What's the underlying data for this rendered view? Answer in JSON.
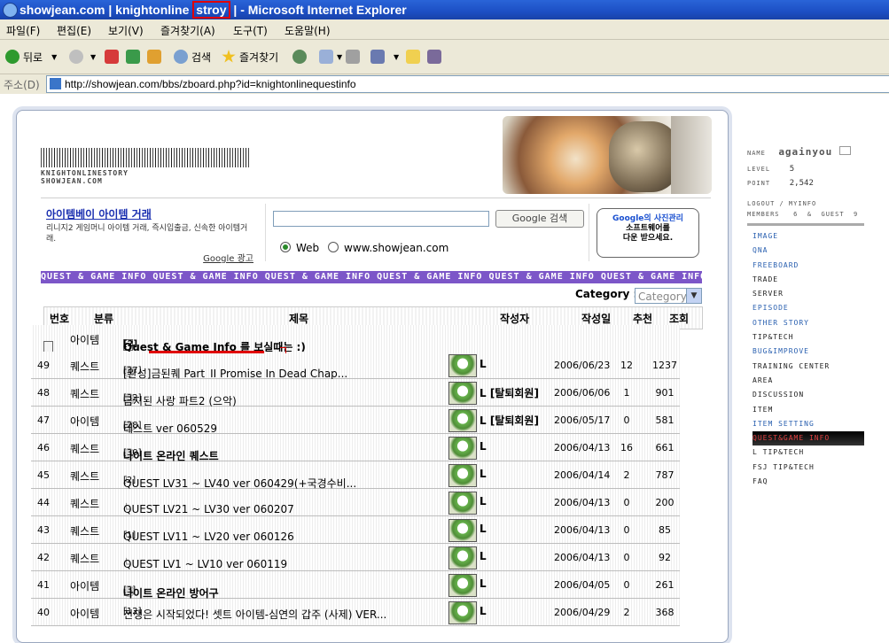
{
  "window": {
    "title_pre": "showjean.com | knightonline ",
    "title_highlight": "stroy",
    "title_post": " | - Microsoft Internet Explorer"
  },
  "menu": [
    "파일(F)",
    "편집(E)",
    "보기(V)",
    "즐겨찾기(A)",
    "도구(T)",
    "도움말(H)"
  ],
  "toolbar": {
    "back": "뒤로",
    "search": "검색",
    "favorites": "즐겨찾기"
  },
  "address": {
    "label": "주소(D)",
    "url": "http://showjean.com/bbs/zboard.php?id=knightonlinequestinfo"
  },
  "site": {
    "brand_line1": "KNIGHTONLINESTORY",
    "brand_line2": "SHOWJEAN.COM"
  },
  "ad": {
    "title": "아이템베이 아이템 거래",
    "desc": "리니지2 게임머니 아이템 거래, 즉시입출금, 신속한 아이템거래.",
    "google_label": "Google 광고"
  },
  "search": {
    "button": "Google 검색",
    "radio_web": "Web",
    "radio_site": "www.showjean.com",
    "promo_line1": "Google의 사진관리",
    "promo_line2": "소프트웨어를",
    "promo_line3": "다운 받으세요."
  },
  "marquee": "QUEST & GAME INFO QUEST & GAME INFO QUEST & GAME INFO QUEST & GAME INFO QUEST & GAME INFO QUEST & GAME INFO",
  "category": {
    "label": "Category :",
    "selected": "Category"
  },
  "table": {
    "headers": {
      "no": "번호",
      "cat": "분류",
      "title": "제목",
      "writer": "작성자",
      "date": "작성일",
      "rec": "추천",
      "views": "조회"
    },
    "notice": {
      "cat": "아이템",
      "title": "Quest & Game Info 를 보실때는 :)",
      "comments": "[2]"
    },
    "rows": [
      {
        "no": "49",
        "cat": "퀘스트",
        "title": "[완성]금된퀘 Part_II Promise In Dead Chap...",
        "comments": "[37]",
        "writer": "L",
        "date": "2006/06/23",
        "rec": "12",
        "views": "1237"
      },
      {
        "no": "48",
        "cat": "퀘스트",
        "title": "금지된 사랑 파트2 (으악)",
        "comments": "[32]",
        "writer": "L [탈퇴회원]",
        "date": "2006/06/06",
        "rec": "1",
        "views": "901"
      },
      {
        "no": "47",
        "cat": "아이템",
        "title": "테스트 ver 060529",
        "comments": "[28]",
        "writer": "L [탈퇴회원]",
        "date": "2006/05/17",
        "rec": "0",
        "views": "581"
      },
      {
        "no": "46",
        "cat": "퀘스트",
        "title": "나이트 온라인 퀘스트",
        "comments": "[30]",
        "writer": "L",
        "date": "2006/04/13",
        "rec": "16",
        "views": "661"
      },
      {
        "no": "45",
        "cat": "퀘스트",
        "title": "QUEST LV31 ~ LV40 ver 060429(+국경수비...",
        "comments": "[2]",
        "writer": "L",
        "date": "2006/04/14",
        "rec": "2",
        "views": "787"
      },
      {
        "no": "44",
        "cat": "퀘스트",
        "title": "QUEST LV21 ~ LV30 ver 060207",
        "comments": "",
        "writer": "L",
        "date": "2006/04/13",
        "rec": "0",
        "views": "200"
      },
      {
        "no": "43",
        "cat": "퀘스트",
        "title": "QUEST LV11 ~ LV20 ver 060126",
        "comments": "[1]",
        "writer": "L",
        "date": "2006/04/13",
        "rec": "0",
        "views": "85"
      },
      {
        "no": "42",
        "cat": "퀘스트",
        "title": "QUEST LV1 ~ LV10 ver 060119",
        "comments": "",
        "writer": "L",
        "date": "2006/04/13",
        "rec": "0",
        "views": "92"
      },
      {
        "no": "41",
        "cat": "아이템",
        "title": "나이트 온라인 방어구",
        "comments": "[3]",
        "writer": "L",
        "date": "2006/04/05",
        "rec": "0",
        "views": "261"
      },
      {
        "no": "40",
        "cat": "아이템",
        "title": "전쟁은 시작되었다! 셋트 아이템-심연의 갑주 (사제) VER...",
        "comments": "[12]",
        "writer": "L",
        "date": "2006/04/29",
        "rec": "2",
        "views": "368"
      }
    ]
  },
  "sidebar": {
    "name_label": "NAME",
    "name": "againyou",
    "level_label": "LEVEL",
    "level": "5",
    "point_label": "POINT",
    "point": "2,542",
    "logout_line": "LOGOUT / MYINFO",
    "members_label": "MEMBERS",
    "members": "6",
    "amp": "&",
    "guest_label": "GUEST",
    "guest": "9",
    "nav": [
      "IMAGE",
      "QNA",
      "FREEBOARD",
      "TRADE",
      "SERVER",
      "EPISODE",
      "OTHER STORY",
      "TIP&TECH",
      "BUG&IMPROVE",
      "TRAINING CENTER",
      "AREA",
      "DISCUSSION",
      "ITEM",
      "ITEM SETTING",
      "QUEST&GAME INFO",
      "L TIP&TECH",
      "FSJ TIP&TECH",
      "FAQ"
    ]
  }
}
